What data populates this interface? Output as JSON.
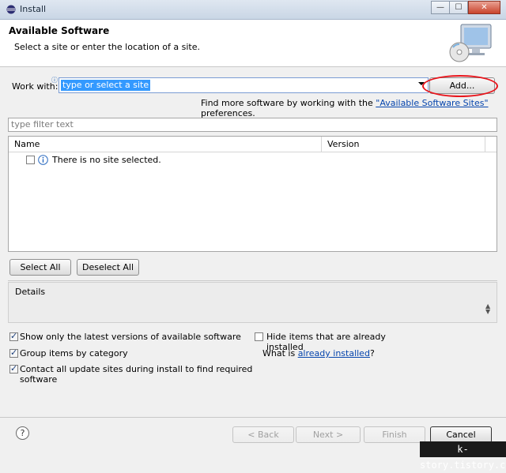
{
  "window": {
    "title": "Install",
    "minimize_glyph": "—",
    "maximize_glyph": "☐",
    "close_glyph": "✕"
  },
  "header": {
    "title": "Available Software",
    "subtitle": "Select a site or enter the location of a site."
  },
  "work_with": {
    "label": "Work with:",
    "value": "type or select a site",
    "add_button": "Add..."
  },
  "find_more": {
    "prefix": "Find more software by working with the ",
    "link": "\"Available Software Sites\"",
    "suffix": " preferences."
  },
  "filter": {
    "placeholder": "type filter text"
  },
  "table": {
    "columns": [
      "Name",
      "Version"
    ],
    "rows": [
      {
        "text": "There is no site selected.",
        "checked": false
      }
    ]
  },
  "buttons": {
    "select_all": "Select All",
    "deselect_all": "Deselect All"
  },
  "details": {
    "label": "Details"
  },
  "options": {
    "show_latest": {
      "label": "Show only the latest versions of available software",
      "checked": true
    },
    "group_category": {
      "label": "Group items by category",
      "checked": true
    },
    "contact_sites": {
      "label": "Contact all update sites during install to find required software",
      "checked": true
    },
    "hide_installed": {
      "label": "Hide items that are already installed",
      "checked": false
    },
    "what_is_prefix": "What is ",
    "what_is_link": "already installed",
    "what_is_suffix": "?"
  },
  "footer": {
    "help_glyph": "?",
    "back": "< Back",
    "next": "Next >",
    "finish": "Finish",
    "cancel": "Cancel"
  },
  "watermark": "k-story.tistory.com",
  "colors": {
    "accent_link": "#0645ad",
    "highlight_ring": "#e8151c",
    "selection": "#3399ff"
  }
}
